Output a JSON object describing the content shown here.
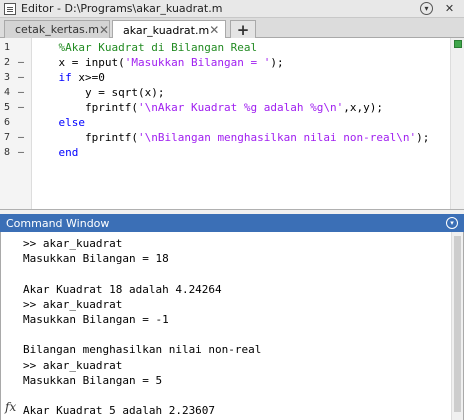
{
  "editor": {
    "title": "Editor - D:\\Programs\\akar_kuadrat.m",
    "tabs": [
      {
        "label": "cetak_kertas.m",
        "close": "✕"
      },
      {
        "label": "akar_kuadrat.m",
        "close": "✕"
      }
    ],
    "add_tab": "+",
    "title_ctrls": {
      "options": "▾",
      "close": "✕"
    },
    "lines": [
      {
        "n": "1",
        "dash": "",
        "parts": [
          {
            "t": "    ",
            "c": ""
          },
          {
            "t": "%Akar Kuadrat di Bilangan Real",
            "c": "cmt"
          }
        ]
      },
      {
        "n": "2",
        "dash": "–",
        "parts": [
          {
            "t": "    x = input(",
            "c": ""
          },
          {
            "t": "'Masukkan Bilangan = '",
            "c": "str"
          },
          {
            "t": ");",
            "c": ""
          }
        ]
      },
      {
        "n": "3",
        "dash": "–",
        "parts": [
          {
            "t": "    ",
            "c": ""
          },
          {
            "t": "if",
            "c": "kw"
          },
          {
            "t": " x>=0",
            "c": ""
          }
        ]
      },
      {
        "n": "4",
        "dash": "–",
        "parts": [
          {
            "t": "        y = sqrt(x);",
            "c": ""
          }
        ]
      },
      {
        "n": "5",
        "dash": "–",
        "parts": [
          {
            "t": "        fprintf(",
            "c": ""
          },
          {
            "t": "'\\nAkar Kuadrat %g adalah %g\\n'",
            "c": "str"
          },
          {
            "t": ",x,y);",
            "c": ""
          }
        ]
      },
      {
        "n": "6",
        "dash": "",
        "parts": [
          {
            "t": "    ",
            "c": ""
          },
          {
            "t": "else",
            "c": "kw"
          }
        ]
      },
      {
        "n": "7",
        "dash": "–",
        "parts": [
          {
            "t": "        fprintf(",
            "c": ""
          },
          {
            "t": "'\\nBilangan menghasilkan nilai non-real\\n'",
            "c": "str"
          },
          {
            "t": ");",
            "c": ""
          }
        ]
      },
      {
        "n": "8",
        "dash": "–",
        "parts": [
          {
            "t": "    ",
            "c": ""
          },
          {
            "t": "end",
            "c": "kw"
          }
        ]
      }
    ]
  },
  "command_window": {
    "title": "Command Window",
    "menu_icon": "▾",
    "lines": [
      ">> akar_kuadrat",
      "Masukkan Bilangan = 18",
      "",
      "Akar Kuadrat 18 adalah 4.24264",
      ">> akar_kuadrat",
      "Masukkan Bilangan = -1",
      "",
      "Bilangan menghasilkan nilai non-real",
      ">> akar_kuadrat",
      "Masukkan Bilangan = 5",
      "",
      "Akar Kuadrat 5 adalah 2.23607"
    ],
    "fx_label": "fx"
  },
  "colors": {
    "keyword": "#0000ff",
    "string": "#a020f0",
    "comment": "#228b22",
    "command_title_bg": "#3b6fb6"
  }
}
